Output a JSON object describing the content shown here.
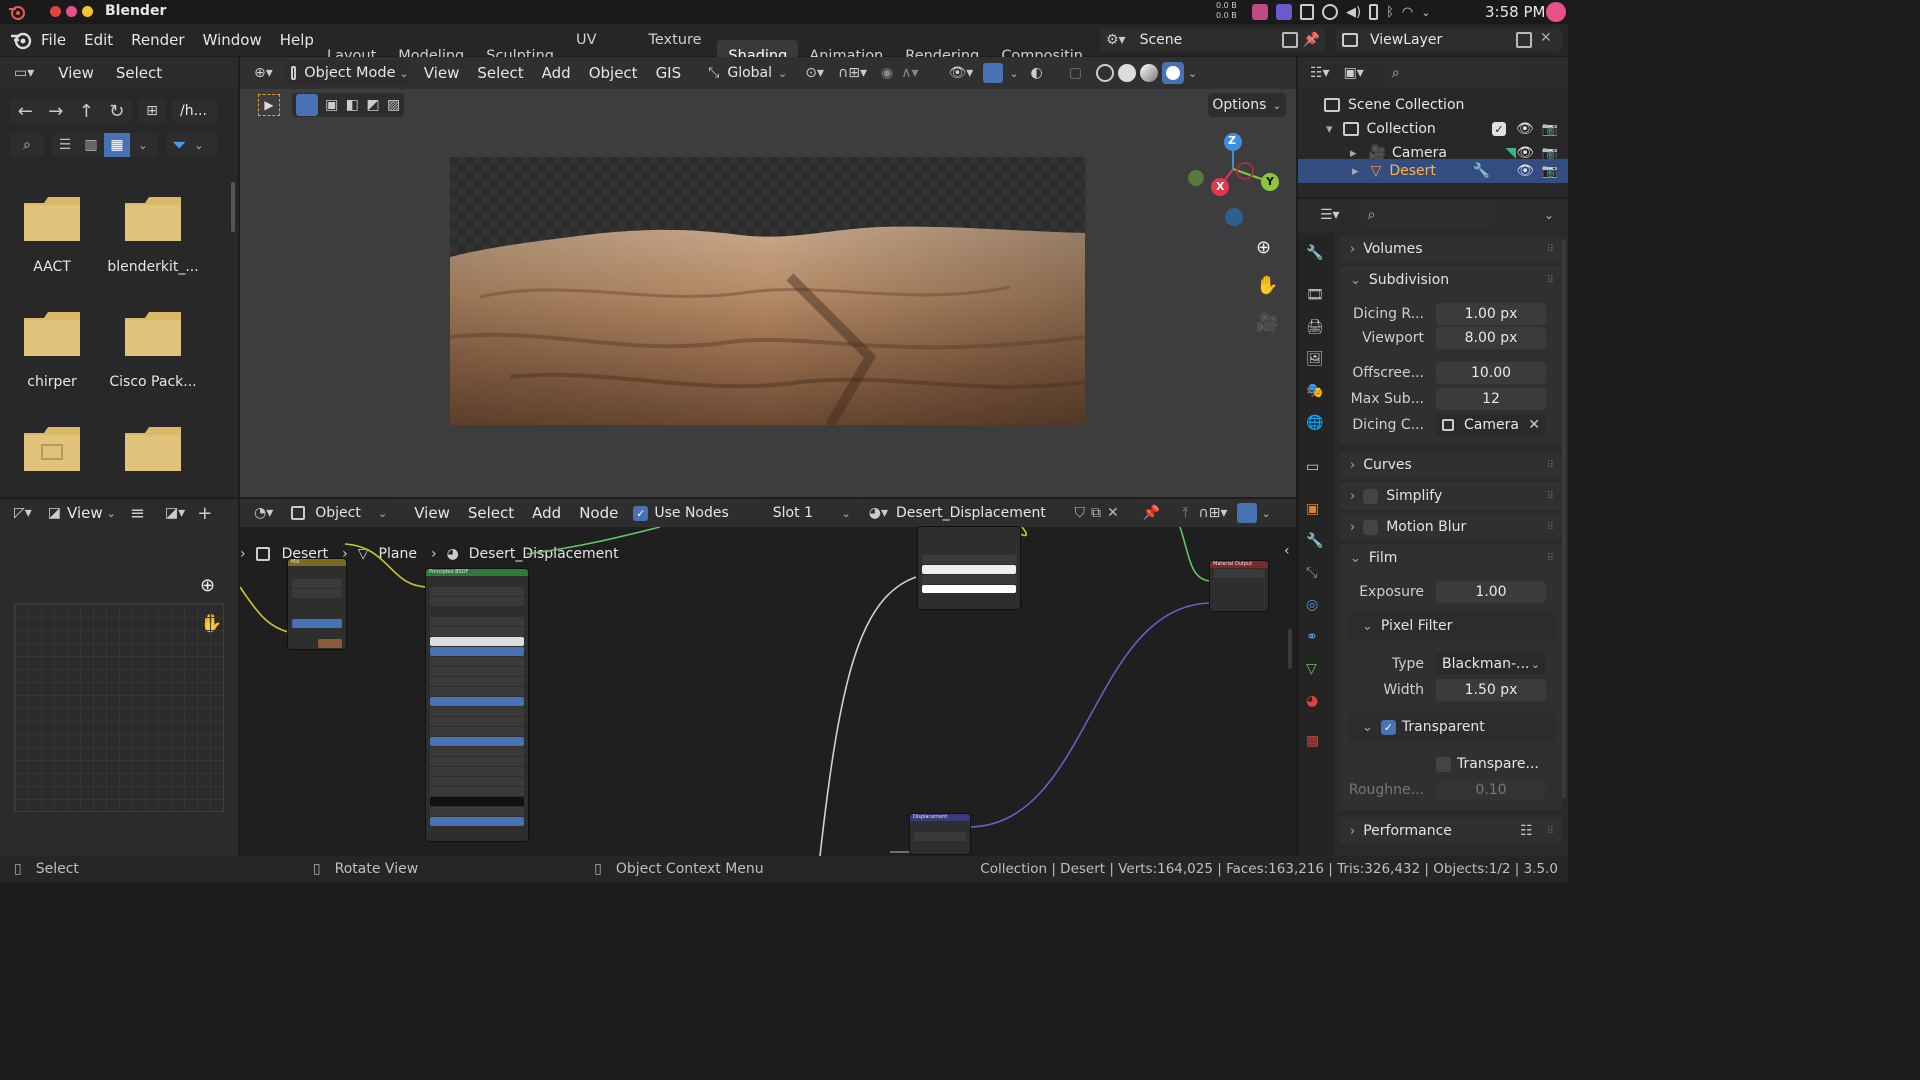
{
  "system": {
    "app_name": "Blender",
    "net_up": "0.0 B",
    "net_down": "0.0 B",
    "time": "3:58 PM"
  },
  "menu": {
    "items": [
      "File",
      "Edit",
      "Render",
      "Window",
      "Help"
    ]
  },
  "workspaces": [
    "Layout",
    "Modeling",
    "Sculpting",
    "UV Editing",
    "Texture Paint",
    "Shading",
    "Animation",
    "Rendering",
    "Compositin"
  ],
  "active_workspace": "Shading",
  "scene": {
    "name": "Scene",
    "view_layer": "ViewLayer"
  },
  "file_browser": {
    "view": "View",
    "select": "Select",
    "path": "/h...",
    "folders": [
      "AACT",
      "blenderkit_...",
      "chirper",
      "Cisco Pack...",
      "",
      ""
    ]
  },
  "viewport": {
    "mode": "Object Mode",
    "menus": [
      "View",
      "Select",
      "Add",
      "Object",
      "GIS"
    ],
    "orientation": "Global",
    "options": "Options",
    "gizmo": {
      "x": "X",
      "y": "Y",
      "z": "Z"
    }
  },
  "outliner": {
    "root": "Scene Collection",
    "collection": "Collection",
    "items": [
      "Camera",
      "Desert"
    ]
  },
  "properties": {
    "panels": {
      "volumes": "Volumes",
      "subdivision": "Subdivision",
      "curves": "Curves",
      "simplify": "Simplify",
      "motion_blur": "Motion Blur",
      "film": "Film",
      "pixel_filter": "Pixel Filter",
      "transparent": "Transparent",
      "performance": "Performance"
    },
    "subdivision": {
      "dicing_render_label": "Dicing R...",
      "dicing_render_value": "1.00 px",
      "viewport_label": "Viewport",
      "viewport_value": "8.00 px",
      "offscreen_label": "Offscree...",
      "offscreen_value": "10.00",
      "max_sub_label": "Max Sub...",
      "max_sub_value": "12",
      "dicing_camera_label": "Dicing C...",
      "dicing_camera_value": "Camera"
    },
    "film": {
      "exposure_label": "Exposure",
      "exposure_value": "1.00",
      "type_label": "Type",
      "type_value": "Blackman-...",
      "width_label": "Width",
      "width_value": "1.50 px",
      "transparent_glass_label": "Transpare...",
      "roughness_label": "Roughne...",
      "roughness_value": "0.10"
    }
  },
  "image_editor": {
    "view": "View"
  },
  "node_editor": {
    "type": "Object",
    "menus": [
      "View",
      "Select",
      "Add",
      "Node"
    ],
    "use_nodes": "Use Nodes",
    "slot": "Slot 1",
    "material": "Desert_Displacement",
    "breadcrumb": [
      "Desert",
      "Plane",
      "Desert_Displacement"
    ],
    "nodes": {
      "mix": "Mix",
      "principled": "Principled BSDF",
      "material_output": "Material Output",
      "displacement": "Displacement"
    }
  },
  "status": {
    "select": "Select",
    "rotate": "Rotate View",
    "context": "Object Context Menu",
    "stats": "Collection | Desert | Verts:164,025 | Faces:163,216 | Tris:326,432 | Objects:1/2 | 3.5.0"
  },
  "colors": {
    "accent": "#4772b3",
    "active_highlight": "#334d80",
    "folder": "#d9b868",
    "x_axis": "#e2384e",
    "y_axis": "#8bc63f",
    "z_axis": "#3f8edb"
  }
}
